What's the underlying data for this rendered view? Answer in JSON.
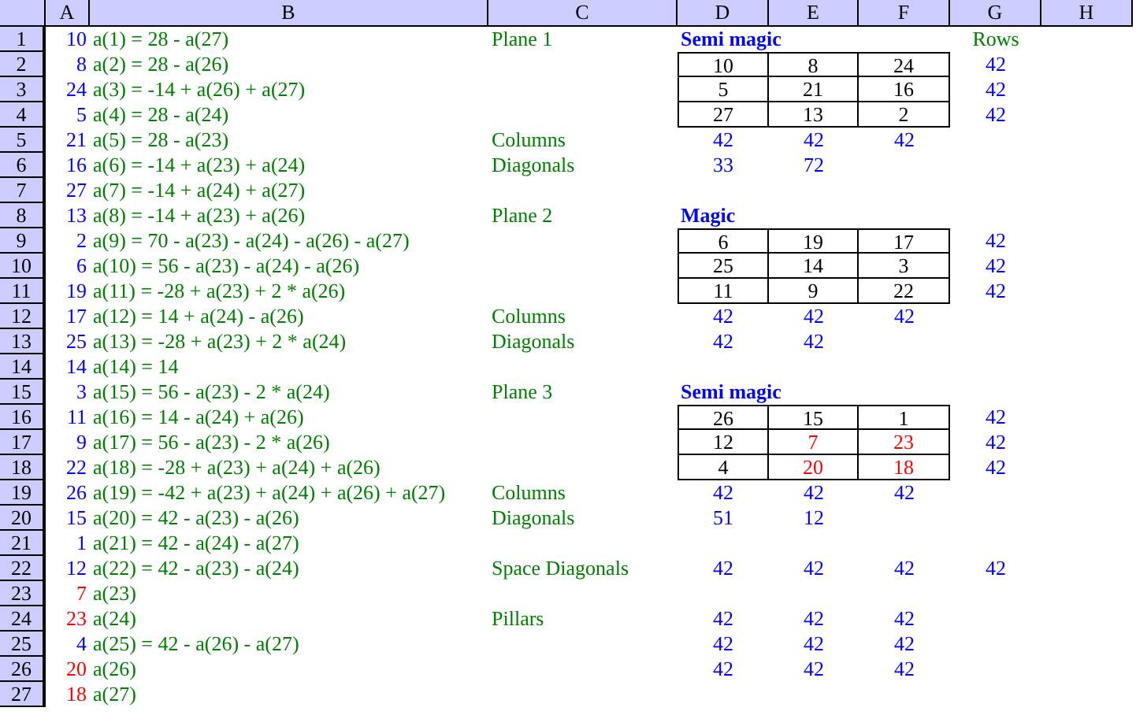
{
  "columns": [
    "A",
    "B",
    "C",
    "D",
    "E",
    "F",
    "G",
    "H"
  ],
  "rows": [
    {
      "number": "1",
      "a": {
        "text": "10",
        "kind": "computed"
      },
      "b": {
        "text": "a(1) = 28 - a(27)",
        "kind": "formula"
      },
      "c": {
        "text": "Plane 1",
        "kind": "label"
      },
      "d": {
        "text": "Semi magic",
        "kind": "heading"
      },
      "g": {
        "text": "Rows",
        "kind": "label"
      }
    },
    {
      "number": "2",
      "a": {
        "text": "8",
        "kind": "computed"
      },
      "b": {
        "text": "a(2) = 28 - a(26)",
        "kind": "formula"
      },
      "d": {
        "text": "10",
        "kind": "square"
      },
      "e": {
        "text": "8",
        "kind": "square"
      },
      "f": {
        "text": "24",
        "kind": "square"
      },
      "g": {
        "text": "42",
        "kind": "sum"
      }
    },
    {
      "number": "3",
      "a": {
        "text": "24",
        "kind": "computed"
      },
      "b": {
        "text": "a(3) = -14 + a(26) + a(27)",
        "kind": "formula"
      },
      "d": {
        "text": "5",
        "kind": "square"
      },
      "e": {
        "text": "21",
        "kind": "square"
      },
      "f": {
        "text": "16",
        "kind": "square"
      },
      "g": {
        "text": "42",
        "kind": "sum"
      }
    },
    {
      "number": "4",
      "a": {
        "text": "5",
        "kind": "computed"
      },
      "b": {
        "text": "a(4) = 28 - a(24)",
        "kind": "formula"
      },
      "d": {
        "text": "27",
        "kind": "square"
      },
      "e": {
        "text": "13",
        "kind": "square"
      },
      "f": {
        "text": "2",
        "kind": "square"
      },
      "g": {
        "text": "42",
        "kind": "sum"
      }
    },
    {
      "number": "5",
      "a": {
        "text": "21",
        "kind": "computed"
      },
      "b": {
        "text": "a(5) = 28 - a(23)",
        "kind": "formula"
      },
      "c": {
        "text": "Columns",
        "kind": "label"
      },
      "d": {
        "text": "42",
        "kind": "sum"
      },
      "e": {
        "text": "42",
        "kind": "sum"
      },
      "f": {
        "text": "42",
        "kind": "sum"
      }
    },
    {
      "number": "6",
      "a": {
        "text": "16",
        "kind": "computed"
      },
      "b": {
        "text": "a(6) = -14 + a(23) + a(24)",
        "kind": "formula"
      },
      "c": {
        "text": "Diagonals",
        "kind": "label"
      },
      "d": {
        "text": "33",
        "kind": "sum"
      },
      "e": {
        "text": "72",
        "kind": "sum"
      }
    },
    {
      "number": "7",
      "a": {
        "text": "27",
        "kind": "computed"
      },
      "b": {
        "text": "a(7) = -14 + a(24) + a(27)",
        "kind": "formula"
      }
    },
    {
      "number": "8",
      "a": {
        "text": "13",
        "kind": "computed"
      },
      "b": {
        "text": "a(8) = -14 + a(23) + a(26)",
        "kind": "formula"
      },
      "c": {
        "text": "Plane 2",
        "kind": "label"
      },
      "d": {
        "text": "Magic",
        "kind": "heading"
      }
    },
    {
      "number": "9",
      "a": {
        "text": "2",
        "kind": "computed"
      },
      "b": {
        "text": "a(9) = 70 - a(23) - a(24) - a(26) - a(27)",
        "kind": "formula"
      },
      "d": {
        "text": "6",
        "kind": "square"
      },
      "e": {
        "text": "19",
        "kind": "square"
      },
      "f": {
        "text": "17",
        "kind": "square"
      },
      "g": {
        "text": "42",
        "kind": "sum"
      }
    },
    {
      "number": "10",
      "a": {
        "text": "6",
        "kind": "computed"
      },
      "b": {
        "text": "a(10) = 56 - a(23) - a(24) - a(26)",
        "kind": "formula"
      },
      "d": {
        "text": "25",
        "kind": "square"
      },
      "e": {
        "text": "14",
        "kind": "square"
      },
      "f": {
        "text": "3",
        "kind": "square"
      },
      "g": {
        "text": "42",
        "kind": "sum"
      }
    },
    {
      "number": "11",
      "a": {
        "text": "19",
        "kind": "computed"
      },
      "b": {
        "text": "a(11) = -28 + a(23) + 2 * a(26)",
        "kind": "formula"
      },
      "d": {
        "text": "11",
        "kind": "square"
      },
      "e": {
        "text": "9",
        "kind": "square"
      },
      "f": {
        "text": "22",
        "kind": "square"
      },
      "g": {
        "text": "42",
        "kind": "sum"
      }
    },
    {
      "number": "12",
      "a": {
        "text": "17",
        "kind": "computed"
      },
      "b": {
        "text": "a(12) = 14 + a(24) - a(26)",
        "kind": "formula"
      },
      "c": {
        "text": "Columns",
        "kind": "label"
      },
      "d": {
        "text": "42",
        "kind": "sum"
      },
      "e": {
        "text": "42",
        "kind": "sum"
      },
      "f": {
        "text": "42",
        "kind": "sum"
      }
    },
    {
      "number": "13",
      "a": {
        "text": "25",
        "kind": "computed"
      },
      "b": {
        "text": "a(13) = -28 + a(23) + 2 * a(24)",
        "kind": "formula"
      },
      "c": {
        "text": "Diagonals",
        "kind": "label"
      },
      "d": {
        "text": "42",
        "kind": "sum"
      },
      "e": {
        "text": "42",
        "kind": "sum"
      }
    },
    {
      "number": "14",
      "a": {
        "text": "14",
        "kind": "computed"
      },
      "b": {
        "text": "a(14) = 14",
        "kind": "formula"
      }
    },
    {
      "number": "15",
      "a": {
        "text": "3",
        "kind": "computed"
      },
      "b": {
        "text": "a(15) = 56 - a(23) - 2 * a(24)",
        "kind": "formula"
      },
      "c": {
        "text": "Plane 3",
        "kind": "label"
      },
      "d": {
        "text": "Semi magic",
        "kind": "heading"
      }
    },
    {
      "number": "16",
      "a": {
        "text": "11",
        "kind": "computed"
      },
      "b": {
        "text": "a(16) = 14 - a(24) + a(26)",
        "kind": "formula"
      },
      "d": {
        "text": "26",
        "kind": "square"
      },
      "e": {
        "text": "15",
        "kind": "square"
      },
      "f": {
        "text": "1",
        "kind": "square"
      },
      "g": {
        "text": "42",
        "kind": "sum"
      }
    },
    {
      "number": "17",
      "a": {
        "text": "9",
        "kind": "computed"
      },
      "b": {
        "text": "a(17) = 56 - a(23) - 2 * a(26)",
        "kind": "formula"
      },
      "d": {
        "text": "12",
        "kind": "square"
      },
      "e": {
        "text": "7",
        "kind": "square-given"
      },
      "f": {
        "text": "23",
        "kind": "square-given"
      },
      "g": {
        "text": "42",
        "kind": "sum"
      }
    },
    {
      "number": "18",
      "a": {
        "text": "22",
        "kind": "computed"
      },
      "b": {
        "text": "a(18) = -28 + a(23) + a(24) + a(26)",
        "kind": "formula"
      },
      "d": {
        "text": "4",
        "kind": "square"
      },
      "e": {
        "text": "20",
        "kind": "square-given"
      },
      "f": {
        "text": "18",
        "kind": "square-given"
      },
      "g": {
        "text": "42",
        "kind": "sum"
      }
    },
    {
      "number": "19",
      "a": {
        "text": "26",
        "kind": "computed"
      },
      "b": {
        "text": "a(19) = -42 + a(23) + a(24) + a(26) + a(27)",
        "kind": "formula"
      },
      "c": {
        "text": "Columns",
        "kind": "label"
      },
      "d": {
        "text": "42",
        "kind": "sum"
      },
      "e": {
        "text": "42",
        "kind": "sum"
      },
      "f": {
        "text": "42",
        "kind": "sum"
      }
    },
    {
      "number": "20",
      "a": {
        "text": "15",
        "kind": "computed"
      },
      "b": {
        "text": "a(20) = 42 - a(23) - a(26)",
        "kind": "formula"
      },
      "c": {
        "text": "Diagonals",
        "kind": "label"
      },
      "d": {
        "text": "51",
        "kind": "sum"
      },
      "e": {
        "text": "12",
        "kind": "sum"
      }
    },
    {
      "number": "21",
      "a": {
        "text": "1",
        "kind": "computed"
      },
      "b": {
        "text": "a(21) = 42 - a(24) - a(27)",
        "kind": "formula"
      }
    },
    {
      "number": "22",
      "a": {
        "text": "12",
        "kind": "computed"
      },
      "b": {
        "text": "a(22) = 42 - a(23) - a(24)",
        "kind": "formula"
      },
      "c": {
        "text": "Space Diagonals",
        "kind": "label"
      },
      "d": {
        "text": "42",
        "kind": "sum"
      },
      "e": {
        "text": "42",
        "kind": "sum"
      },
      "f": {
        "text": "42",
        "kind": "sum"
      },
      "g": {
        "text": "42",
        "kind": "sum"
      }
    },
    {
      "number": "23",
      "a": {
        "text": "7",
        "kind": "given"
      },
      "b": {
        "text": "a(23)",
        "kind": "formula"
      }
    },
    {
      "number": "24",
      "a": {
        "text": "23",
        "kind": "given"
      },
      "b": {
        "text": "a(24)",
        "kind": "formula"
      },
      "c": {
        "text": "Pillars",
        "kind": "label"
      },
      "d": {
        "text": "42",
        "kind": "sum"
      },
      "e": {
        "text": "42",
        "kind": "sum"
      },
      "f": {
        "text": "42",
        "kind": "sum"
      }
    },
    {
      "number": "25",
      "a": {
        "text": "4",
        "kind": "computed"
      },
      "b": {
        "text": "a(25) = 42 - a(26) - a(27)",
        "kind": "formula"
      },
      "d": {
        "text": "42",
        "kind": "sum"
      },
      "e": {
        "text": "42",
        "kind": "sum"
      },
      "f": {
        "text": "42",
        "kind": "sum"
      }
    },
    {
      "number": "26",
      "a": {
        "text": "20",
        "kind": "given"
      },
      "b": {
        "text": "a(26)",
        "kind": "formula"
      },
      "d": {
        "text": "42",
        "kind": "sum"
      },
      "e": {
        "text": "42",
        "kind": "sum"
      },
      "f": {
        "text": "42",
        "kind": "sum"
      }
    },
    {
      "number": "27",
      "a": {
        "text": "18",
        "kind": "given"
      },
      "b": {
        "text": "a(27)",
        "kind": "formula"
      }
    }
  ]
}
